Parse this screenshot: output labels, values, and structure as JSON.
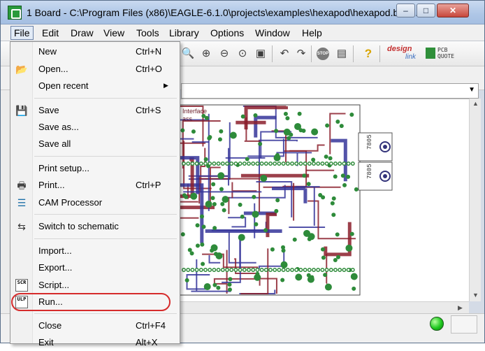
{
  "window": {
    "title": "1 Board - C:\\Program Files (x86)\\EAGLE-6.1.0\\projects\\examples\\hexapod\\hexapod.brd ...",
    "minimize_label": "–",
    "maximize_label": "□",
    "close_label": "✕"
  },
  "menubar": {
    "items": [
      "File",
      "Edit",
      "Draw",
      "View",
      "Tools",
      "Library",
      "Options",
      "Window",
      "Help"
    ]
  },
  "toolbar": {
    "icons": [
      "zoom-fit-icon",
      "zoom-in-icon",
      "zoom-out-icon",
      "zoom-redraw-icon",
      "zoom-select-icon",
      "undo-icon",
      "redo-icon",
      "stop-icon",
      "go-icon",
      "help-icon"
    ],
    "stop_label": "STOP",
    "designlink_top": "design",
    "designlink_bottom": "link",
    "pcbquote_label": "PCB\nQUOTE"
  },
  "board": {
    "label_interface": "Interface",
    "label_ass": "ass",
    "regulator_1": "7805",
    "regulator_2": "7805"
  },
  "file_menu": {
    "items": [
      {
        "label": "New",
        "shortcut": "Ctrl+N",
        "icon": ""
      },
      {
        "label": "Open...",
        "shortcut": "Ctrl+O",
        "icon": "open-folder-icon"
      },
      {
        "label": "Open recent",
        "shortcut": "",
        "icon": "",
        "submenu": true
      },
      {
        "label": "Save",
        "shortcut": "Ctrl+S",
        "icon": "save-disk-icon"
      },
      {
        "label": "Save as...",
        "shortcut": "",
        "icon": ""
      },
      {
        "label": "Save all",
        "shortcut": "",
        "icon": ""
      },
      {
        "label": "Print setup...",
        "shortcut": "",
        "icon": ""
      },
      {
        "label": "Print...",
        "shortcut": "Ctrl+P",
        "icon": "printer-icon"
      },
      {
        "label": "CAM Processor",
        "shortcut": "",
        "icon": "cam-processor-icon"
      },
      {
        "label": "Switch to schematic",
        "shortcut": "",
        "icon": "schematic-switch-icon"
      },
      {
        "label": "Import...",
        "shortcut": "",
        "icon": ""
      },
      {
        "label": "Export...",
        "shortcut": "",
        "icon": ""
      },
      {
        "label": "Script...",
        "shortcut": "",
        "icon": "script-scr-icon"
      },
      {
        "label": "Run...",
        "shortcut": "",
        "icon": "run-ulp-icon"
      },
      {
        "label": "Close",
        "shortcut": "Ctrl+F4",
        "icon": ""
      },
      {
        "label": "Exit",
        "shortcut": "Alt+X",
        "icon": ""
      }
    ],
    "script_icon_text": "SCR",
    "ulp_icon_text": "ULP",
    "submenu_arrow": "▶"
  },
  "colors": {
    "trace_red": "#8b1f2c",
    "trace_blue": "#35359a",
    "pad_green": "#2e8b3a",
    "highlight": "#d62b2b"
  }
}
